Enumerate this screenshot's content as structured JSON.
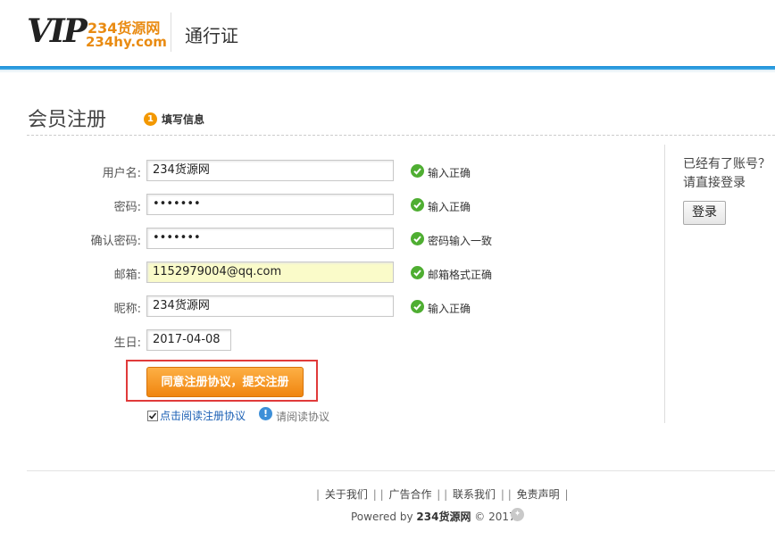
{
  "header": {
    "logo_mark": "VIP",
    "logo_top": "234货源网",
    "logo_bottom": "234hy.com",
    "title": "通行证"
  },
  "page": {
    "title": "会员注册",
    "step_number": "1",
    "step_label": "填写信息"
  },
  "form": {
    "fields": [
      {
        "label": "用户名:",
        "value": "234货源网",
        "status": "输入正确"
      },
      {
        "label": "密码:",
        "value": "•••••••",
        "status": "输入正确"
      },
      {
        "label": "确认密码:",
        "value": "•••••••",
        "status": "密码输入一致"
      },
      {
        "label": "邮箱:",
        "value": "1152979004@qq.com",
        "status": "邮箱格式正确"
      },
      {
        "label": "昵称:",
        "value": "234货源网",
        "status": "输入正确"
      },
      {
        "label": "生日:",
        "value": "2017-04-08"
      }
    ],
    "submit_label": "同意注册协议，提交注册",
    "agree_checked": true,
    "agree_label": "点击阅读注册协议",
    "notice": "请阅读协议"
  },
  "sidebar": {
    "line1": "已经有了账号？",
    "line2": "请直接登录",
    "login_label": "登录"
  },
  "footer": {
    "links": [
      "关于我们",
      "广告合作",
      "联系我们",
      "免责声明"
    ],
    "powered_prefix": "Powered by",
    "powered_brand": "234货源网",
    "powered_suffix": "© 2017"
  },
  "colors": {
    "accent_blue": "#1a8fd8",
    "brand_orange": "#e98b12",
    "success_green": "#4fae32",
    "highlight_red": "#e03a3a"
  },
  "icons": {
    "success": "check-circle-icon",
    "info": "info-circle-icon",
    "badge": "shield-icon"
  }
}
